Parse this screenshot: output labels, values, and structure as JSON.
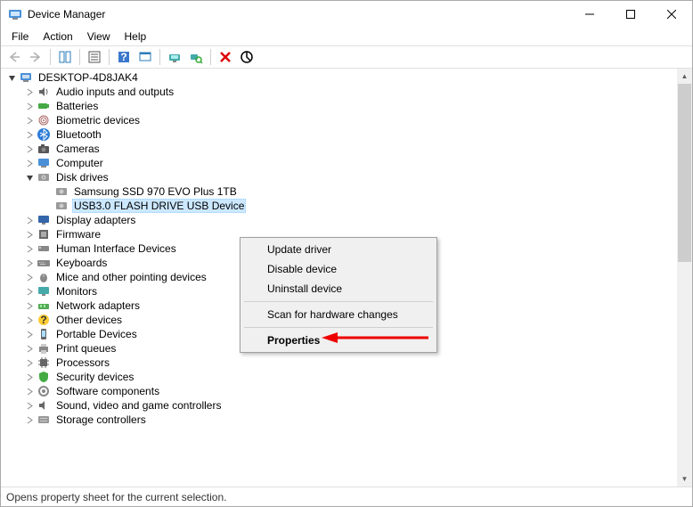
{
  "window": {
    "title": "Device Manager"
  },
  "menu": {
    "file": "File",
    "action": "Action",
    "view": "View",
    "help": "Help"
  },
  "computerName": "DESKTOP-4D8JAK4",
  "categories": {
    "audio": "Audio inputs and outputs",
    "batteries": "Batteries",
    "biometric": "Biometric devices",
    "bluetooth": "Bluetooth",
    "cameras": "Cameras",
    "computer": "Computer",
    "diskdrives": "Disk drives",
    "display": "Display adapters",
    "firmware": "Firmware",
    "hid": "Human Interface Devices",
    "keyboards": "Keyboards",
    "mice": "Mice and other pointing devices",
    "monitors": "Monitors",
    "network": "Network adapters",
    "other": "Other devices",
    "portable": "Portable Devices",
    "printq": "Print queues",
    "processors": "Processors",
    "security": "Security devices",
    "software": "Software components",
    "svg": "Sound, video and game controllers",
    "storage": "Storage controllers"
  },
  "diskChildren": {
    "ssd": "Samsung SSD 970 EVO Plus 1TB",
    "usb": "USB3.0 FLASH DRIVE USB Device"
  },
  "contextMenu": {
    "update": "Update driver",
    "disable": "Disable device",
    "uninstall": "Uninstall device",
    "scan": "Scan for hardware changes",
    "properties": "Properties"
  },
  "status": "Opens property sheet for the current selection."
}
